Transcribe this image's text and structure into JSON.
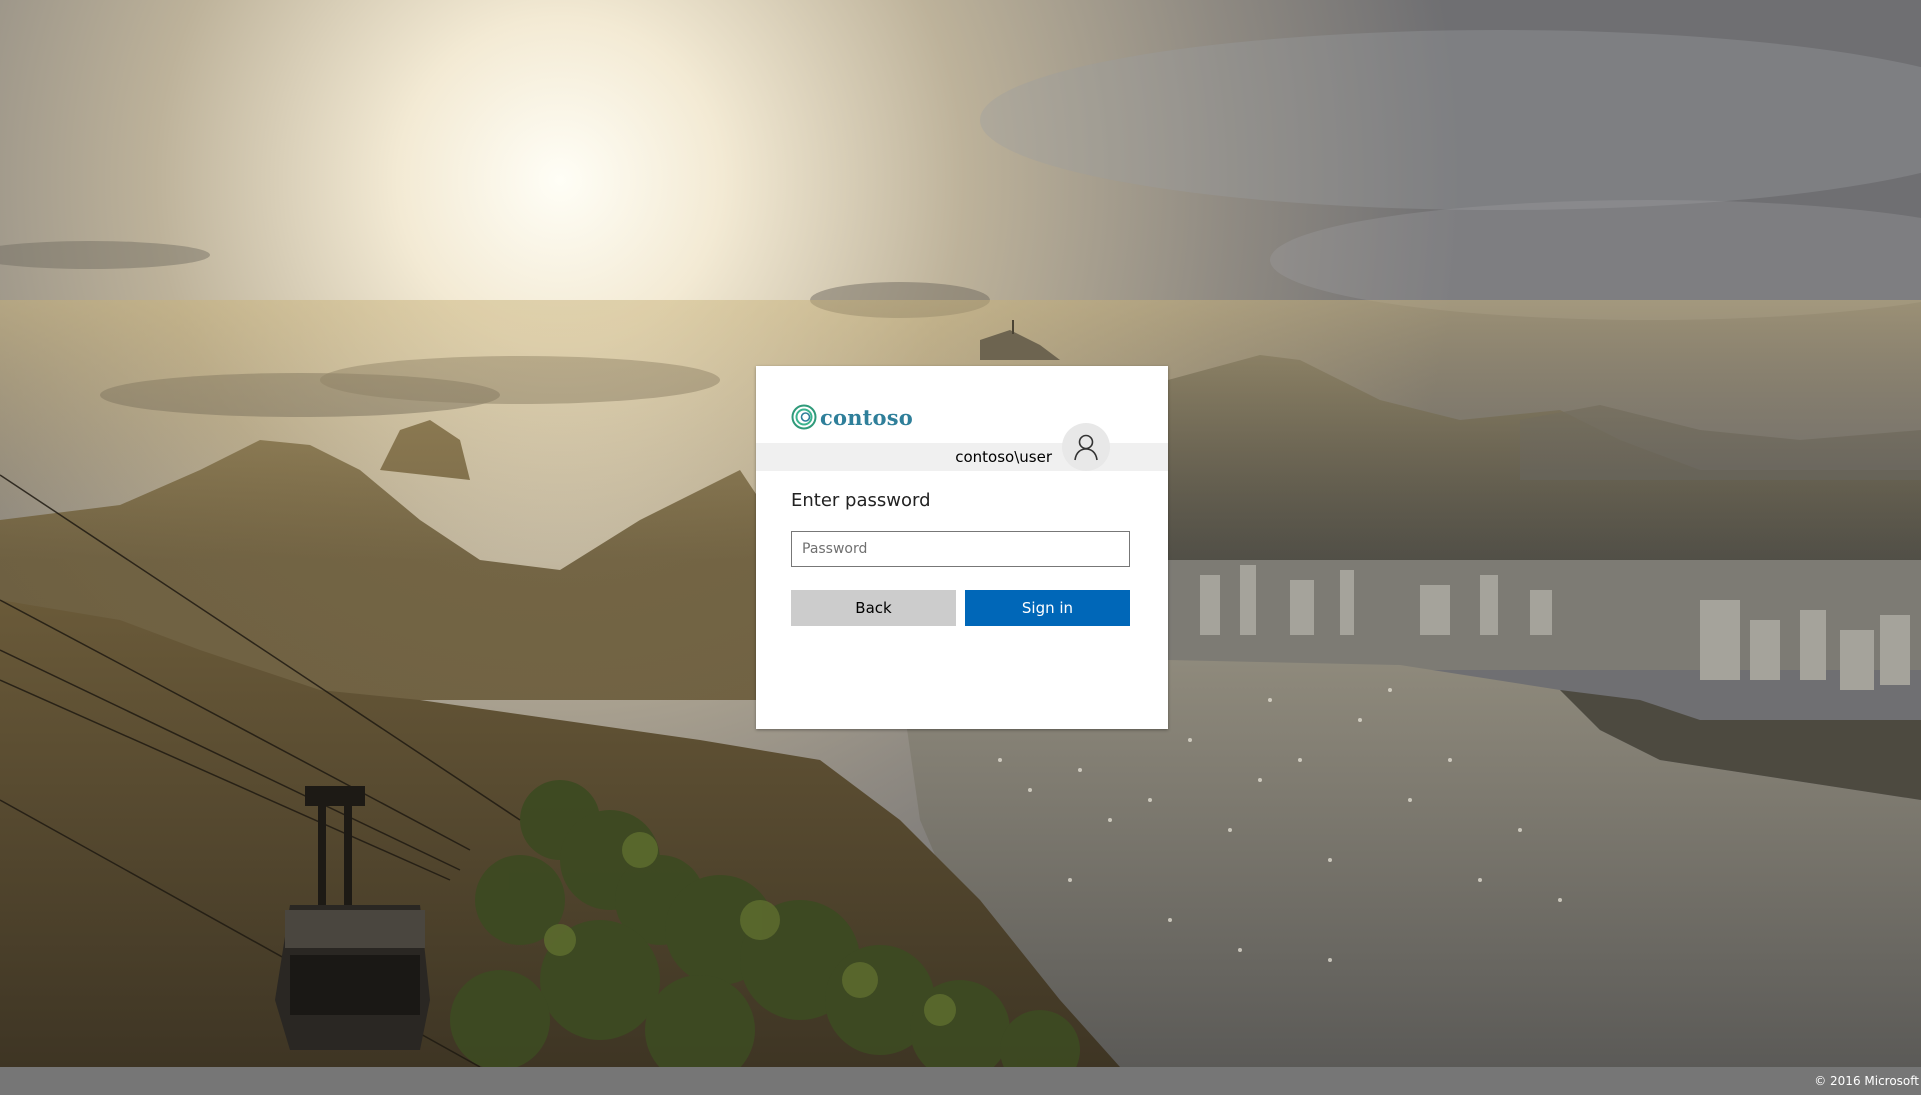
{
  "background": {
    "description_icon": "landscape-photo"
  },
  "card": {
    "logo": {
      "text": "contoso",
      "icon": "contoso-logo-icon",
      "color": "#2f7f9a"
    },
    "identity": {
      "username": "contoso\\user",
      "avatar_icon": "user-avatar-icon"
    },
    "heading": "Enter password",
    "password_field": {
      "placeholder": "Password",
      "value": ""
    },
    "buttons": {
      "back_label": "Back",
      "signin_label": "Sign in"
    },
    "colors": {
      "primary": "#0067b8",
      "secondary": "#cccccc"
    }
  },
  "footer": {
    "copyright": "© 2016 Microsoft",
    "background": "#767676"
  }
}
